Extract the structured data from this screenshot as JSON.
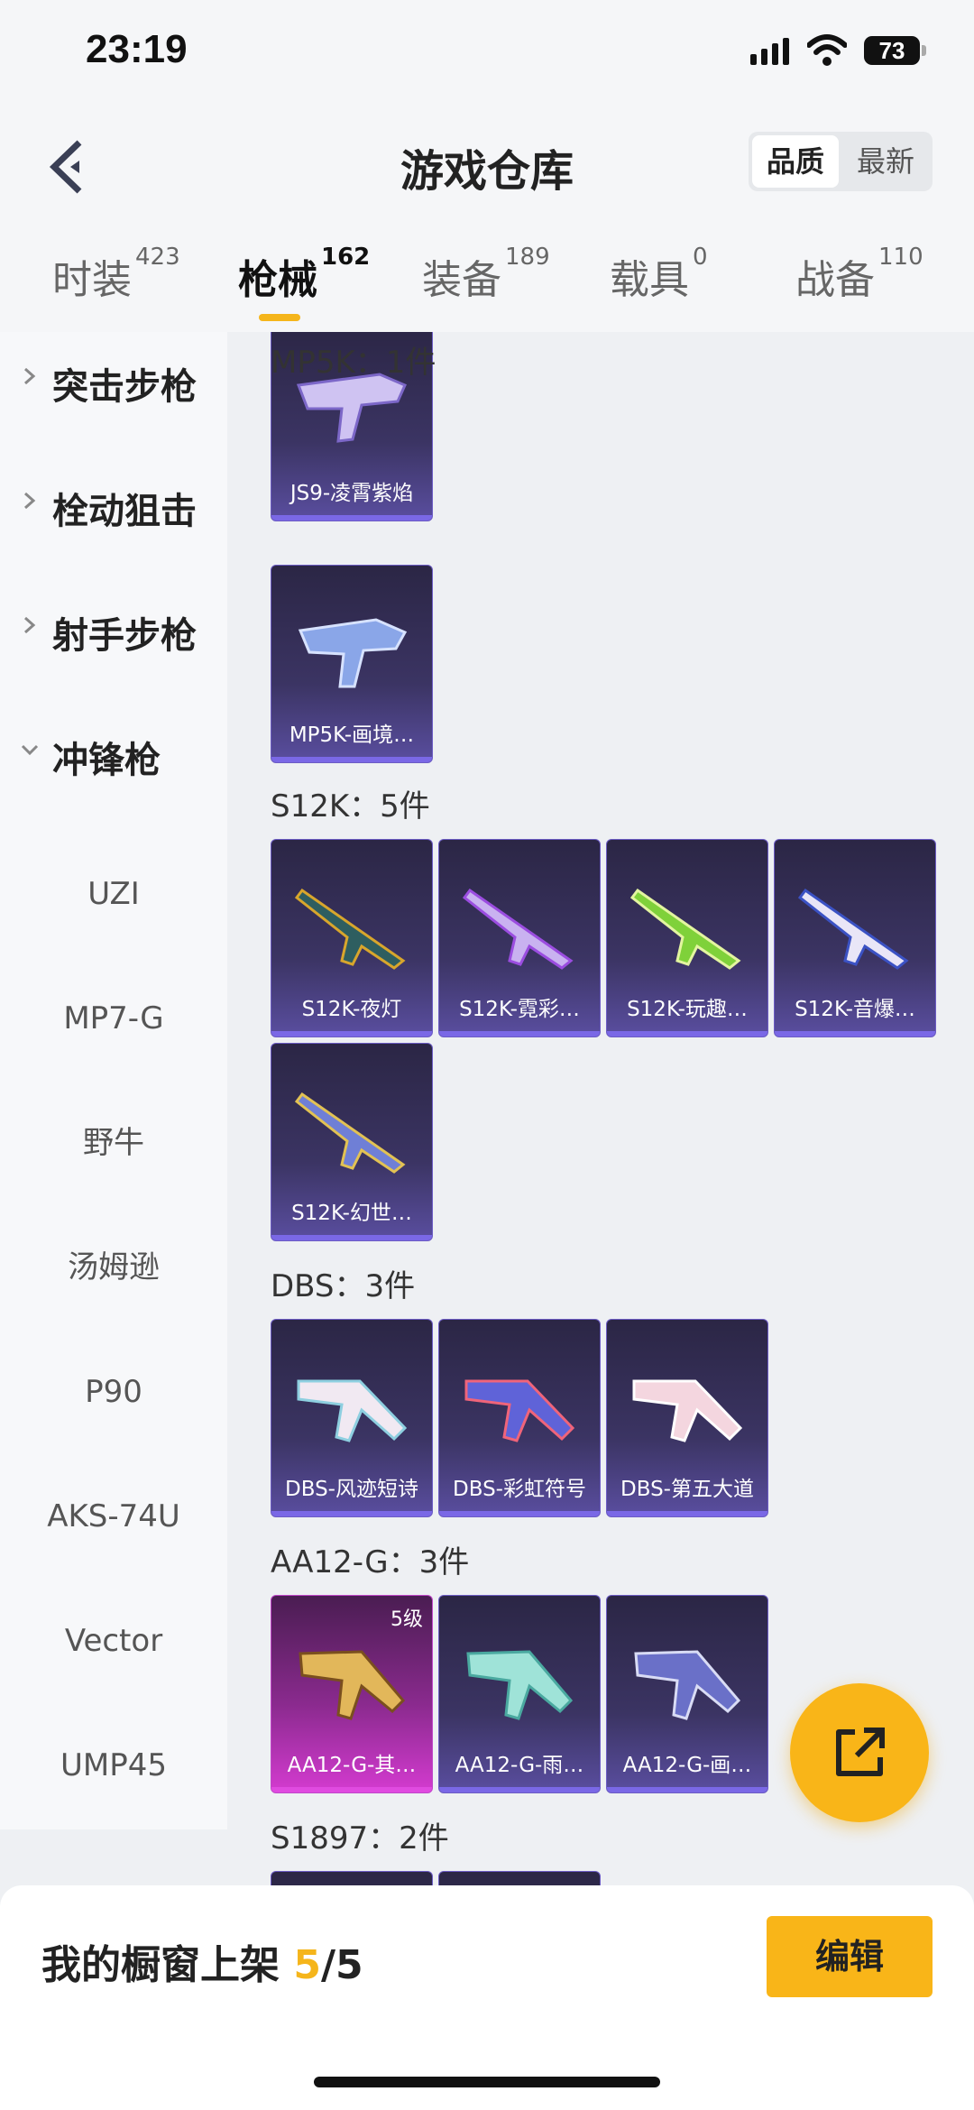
{
  "status_bar": {
    "time": "23:19",
    "battery": "73"
  },
  "header": {
    "title": "游戏仓库",
    "sort_options": [
      "品质",
      "最新"
    ],
    "active_sort": "品质"
  },
  "tabs": [
    {
      "label": "时装",
      "count": "423"
    },
    {
      "label": "枪械",
      "count": "162"
    },
    {
      "label": "装备",
      "count": "189"
    },
    {
      "label": "载具",
      "count": "0"
    },
    {
      "label": "战备",
      "count": "110"
    }
  ],
  "active_tab": "枪械",
  "sidebar": {
    "categories": [
      {
        "label": "突击步枪",
        "expanded": false
      },
      {
        "label": "栓动狙击",
        "expanded": false
      },
      {
        "label": "射手步枪",
        "expanded": false
      },
      {
        "label": "冲锋枪",
        "expanded": true
      }
    ],
    "subitems": [
      "UZI",
      "MP7-G",
      "野牛",
      "汤姆逊",
      "P90",
      "AKS-74U",
      "Vector",
      "UMP45"
    ]
  },
  "groups": [
    {
      "title": "",
      "items": [
        {
          "name": "JS9-凌霄紫焰"
        }
      ]
    },
    {
      "title": "MP5K：1件",
      "items": [
        {
          "name": "MP5K-画境…"
        }
      ]
    },
    {
      "title": "S12K：5件",
      "items": [
        {
          "name": "S12K-夜灯"
        },
        {
          "name": "S12K-霓彩…"
        },
        {
          "name": "S12K-玩趣…"
        },
        {
          "name": "S12K-音爆…"
        },
        {
          "name": "S12K-幻世…"
        }
      ]
    },
    {
      "title": "DBS：3件",
      "items": [
        {
          "name": "DBS-风迹短诗"
        },
        {
          "name": "DBS-彩虹符号"
        },
        {
          "name": "DBS-第五大道"
        }
      ]
    },
    {
      "title": "AA12-G：3件",
      "items": [
        {
          "name": "AA12-G-其…",
          "level": "5级",
          "rarity": "pink"
        },
        {
          "name": "AA12-G-雨…"
        },
        {
          "name": "AA12-G-画…"
        }
      ]
    },
    {
      "title": "S1897：2件",
      "items": []
    }
  ],
  "bottom_bar": {
    "label": "我的橱窗上架",
    "current": "5",
    "total": "/5",
    "edit": "编辑"
  },
  "colors": {
    "accent": "#f9b518",
    "card": "#3b3463",
    "card_rare": "#d43bd0"
  }
}
